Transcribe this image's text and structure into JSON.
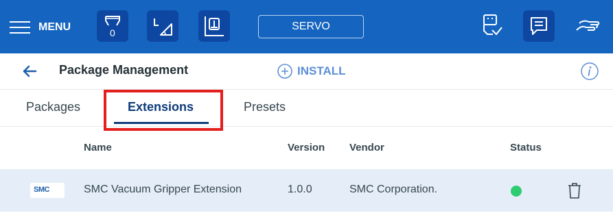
{
  "colors": {
    "topbar": "#1565c0",
    "topbar_button": "#0d47a1",
    "accent": "#5c8fd6",
    "active_tab": "#0d3c7a",
    "highlight": "#e41d1d",
    "status_ok": "#2ecc71",
    "row_bg": "#e4edf8"
  },
  "topbar": {
    "menu_label": "MENU",
    "counter_value": "0",
    "servo_label": "SERVO",
    "icons": [
      "menu-icon",
      "gripper-icon",
      "angle-icon",
      "frame-icon",
      "usb-icon",
      "message-icon",
      "hand-guide-icon"
    ]
  },
  "header": {
    "title": "Package Management",
    "install_label": "INSTALL",
    "icons": [
      "back-arrow-icon",
      "plus-circle-icon",
      "info-icon"
    ]
  },
  "tabs": [
    {
      "label": "Packages",
      "active": false
    },
    {
      "label": "Extensions",
      "active": true
    },
    {
      "label": "Presets",
      "active": false
    }
  ],
  "table": {
    "columns": [
      "Name",
      "Version",
      "Vendor",
      "Status"
    ],
    "rows": [
      {
        "logo_text": "SMC",
        "name": "SMC Vacuum Gripper Extension",
        "version": "1.0.0",
        "vendor": "SMC Corporation.",
        "status": "active"
      }
    ]
  }
}
